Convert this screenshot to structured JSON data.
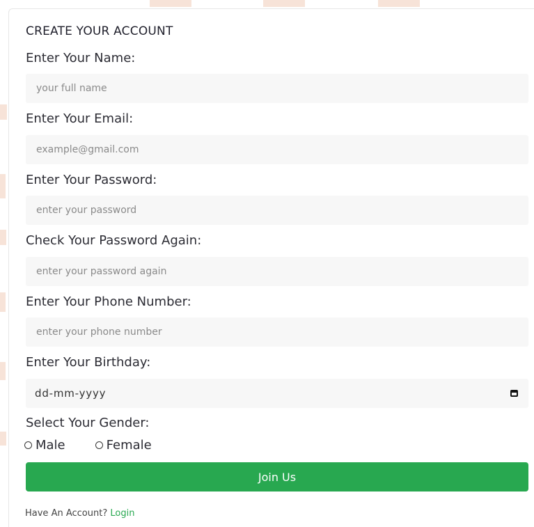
{
  "form": {
    "title": "CREATE YOUR ACCOUNT",
    "name": {
      "label": "Enter Your Name:",
      "placeholder": "your full name",
      "value": ""
    },
    "email": {
      "label": "Enter Your Email:",
      "placeholder": "example@gmail.com",
      "value": ""
    },
    "password": {
      "label": "Enter Your Password:",
      "placeholder": "enter your password",
      "value": ""
    },
    "password_again": {
      "label": "Check Your Password Again:",
      "placeholder": "enter your password again",
      "value": ""
    },
    "phone": {
      "label": "Enter Your Phone Number:",
      "placeholder": "enter your phone number",
      "value": ""
    },
    "birthday": {
      "label": "Enter Your Birthday:",
      "display": "dd-mm-yyyy",
      "icon": "calendar-icon"
    },
    "gender": {
      "label": "Select Your Gender:",
      "options": [
        {
          "label": "Male",
          "selected": false
        },
        {
          "label": "Female",
          "selected": false
        }
      ]
    },
    "submit_label": "Join Us",
    "footer": {
      "text": "Have An Account? ",
      "link_label": "Login"
    }
  },
  "colors": {
    "accent": "#28a850",
    "field_bg": "#f7f7f7",
    "text": "#2b2b33"
  }
}
